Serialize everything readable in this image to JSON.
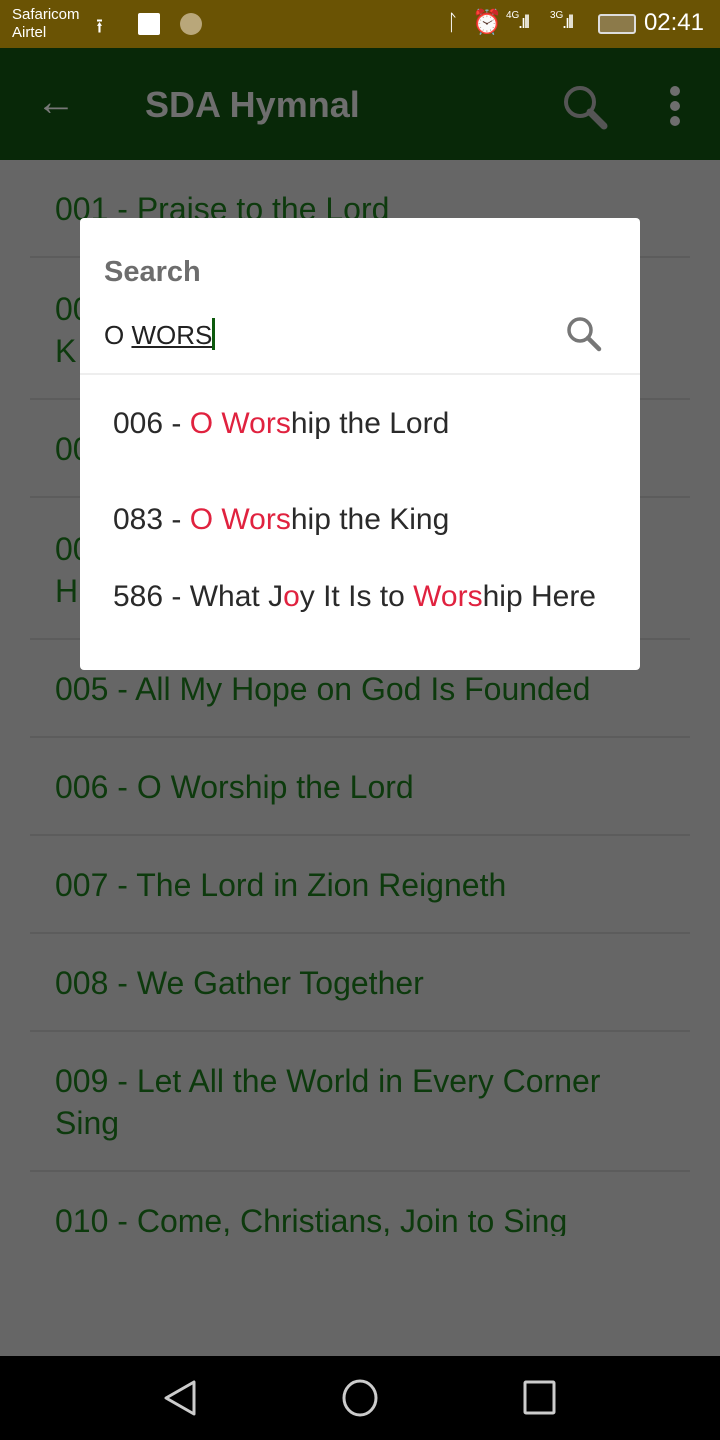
{
  "status_bar": {
    "carrier1": "Safaricom",
    "carrier2": "Airtel",
    "time": "02:41",
    "net1": "4G",
    "net2": "3G",
    "icons": [
      "upload-icon",
      "image-icon",
      "coin-icon",
      "bluetooth-icon",
      "alarm-icon",
      "signal-icon",
      "signal-icon",
      "battery-charging-icon"
    ]
  },
  "toolbar": {
    "title": "SDA Hymnal",
    "back_icon": "arrow-left-icon",
    "search_icon": "search-icon",
    "menu_icon": "more-vert-icon"
  },
  "list": {
    "items": [
      "001 - Praise to the Lord",
      "00\nK",
      "00",
      "00\nH",
      "005 - All My Hope on God Is Founded",
      "006 - O Worship the Lord",
      "007 - The Lord in Zion Reigneth",
      "008 - We Gather Together",
      "009 - Let All the World in Every Corner Sing",
      "010 - Come, Christians, Join to Sing"
    ]
  },
  "dialog": {
    "title": "Search",
    "query_prefix": "O ",
    "query_composing": "WORS",
    "results": [
      {
        "segments": [
          "006 - ",
          "O Wors",
          "hip the Lord"
        ]
      },
      {
        "segments": [
          "083 - ",
          "O Wors",
          "hip the King"
        ]
      },
      {
        "segments": [
          "586 - What J",
          "o",
          "y It Is to ",
          "Wors",
          "hip Here"
        ]
      }
    ]
  },
  "colors": {
    "highlight": "#e0223f",
    "toolbar": "#082808",
    "status_bar": "#6a5304",
    "list_text": "#0d3a0d"
  }
}
